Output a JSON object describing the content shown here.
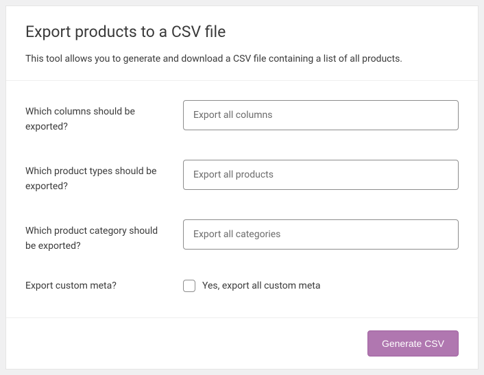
{
  "header": {
    "title": "Export products to a CSV file",
    "description": "This tool allows you to generate and download a CSV file containing a list of all products."
  },
  "fields": {
    "columns": {
      "label": "Which columns should be exported?",
      "placeholder": "Export all columns"
    },
    "types": {
      "label": "Which product types should be exported?",
      "placeholder": "Export all products"
    },
    "category": {
      "label": "Which product category should be exported?",
      "placeholder": "Export all categories"
    },
    "meta": {
      "label": "Export custom meta?",
      "checkbox_label": "Yes, export all custom meta"
    }
  },
  "footer": {
    "submit_label": "Generate CSV"
  }
}
